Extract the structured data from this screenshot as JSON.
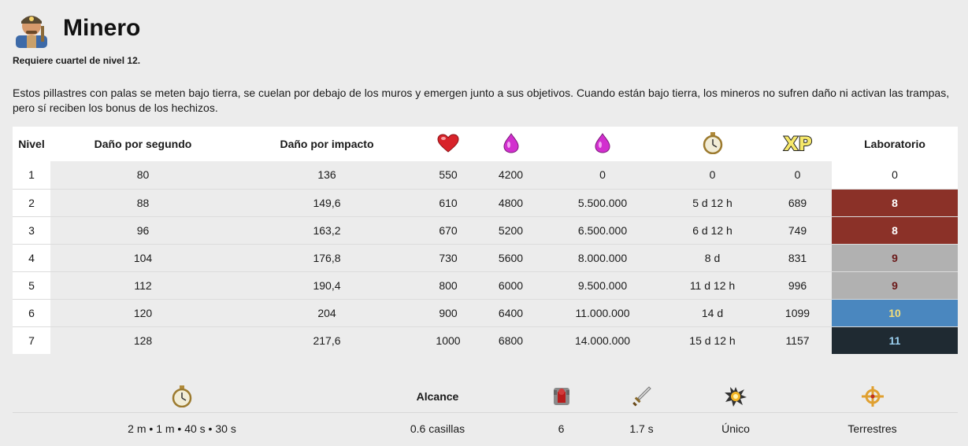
{
  "page": {
    "title": "Minero",
    "requirement": "Requiere cuartel de nivel 12.",
    "description": "Estos pillastres con palas se meten bajo tierra, se cuelan por debajo de los muros y emergen junto a sus objetivos. Cuando están bajo tierra, los mineros no sufren daño ni activan las trampas, pero sí reciben los bonus de los hechizos."
  },
  "table": {
    "headers": {
      "level": "Nivel",
      "dps": "Daño por segundo",
      "dph": "Daño por impacto",
      "hp_icon": "heart-icon",
      "cost_icon": "elixir-icon",
      "research_cost_icon": "elixir-icon",
      "time_icon": "stopwatch-icon",
      "xp_icon": "xp-icon",
      "lab": "Laboratorio"
    },
    "rows": [
      {
        "level": "1",
        "dps": "80",
        "dph": "136",
        "hp": "550",
        "cost": "4200",
        "research": "0",
        "time": "0",
        "xp": "0",
        "lab": "0",
        "lab_bg": "#ffffff",
        "lab_fg": "#1a1a1a"
      },
      {
        "level": "2",
        "dps": "88",
        "dph": "149,6",
        "hp": "610",
        "cost": "4800",
        "research": "5.500.000",
        "time": "5 d 12 h",
        "xp": "689",
        "lab": "8",
        "lab_bg": "#8b3128",
        "lab_fg": "#ffffff"
      },
      {
        "level": "3",
        "dps": "96",
        "dph": "163,2",
        "hp": "670",
        "cost": "5200",
        "research": "6.500.000",
        "time": "6 d 12 h",
        "xp": "749",
        "lab": "8",
        "lab_bg": "#8b3128",
        "lab_fg": "#ffffff"
      },
      {
        "level": "4",
        "dps": "104",
        "dph": "176,8",
        "hp": "730",
        "cost": "5600",
        "research": "8.000.000",
        "time": "8 d",
        "xp": "831",
        "lab": "9",
        "lab_bg": "#b1b1b1",
        "lab_fg": "#6b1a1a"
      },
      {
        "level": "5",
        "dps": "112",
        "dph": "190,4",
        "hp": "800",
        "cost": "6000",
        "research": "9.500.000",
        "time": "11 d 12 h",
        "xp": "996",
        "lab": "9",
        "lab_bg": "#b1b1b1",
        "lab_fg": "#6b1a1a"
      },
      {
        "level": "6",
        "dps": "120",
        "dph": "204",
        "hp": "900",
        "cost": "6400",
        "research": "11.000.000",
        "time": "14 d",
        "xp": "1099",
        "lab": "10",
        "lab_bg": "#4a87bf",
        "lab_fg": "#f2dd7a"
      },
      {
        "level": "7",
        "dps": "128",
        "dph": "217,6",
        "hp": "1000",
        "cost": "6800",
        "research": "14.000.000",
        "time": "15 d 12 h",
        "xp": "1157",
        "lab": "11",
        "lab_bg": "#1f2a32",
        "lab_fg": "#9bd0f0"
      }
    ]
  },
  "stats": {
    "icons": {
      "time": "stopwatch-icon",
      "range_label": "Alcance",
      "housing": "housing-space-icon",
      "attack_speed": "sword-icon",
      "damage_type": "explosion-icon",
      "targets": "target-crosshair-icon"
    },
    "values": {
      "time": "2 m • 1 m • 40 s • 30 s",
      "range": "0.6 casillas",
      "housing": "6",
      "attack_speed": "1.7 s",
      "damage_type": "Único",
      "targets": "Terrestres"
    }
  },
  "colors": {
    "page_bg": "#ececec",
    "lab_red": "#8b3128",
    "lab_gray": "#b1b1b1",
    "lab_blue": "#4a87bf",
    "lab_dark": "#1f2a32",
    "elixir": "#d22fcf",
    "heart": "#d8232a"
  }
}
